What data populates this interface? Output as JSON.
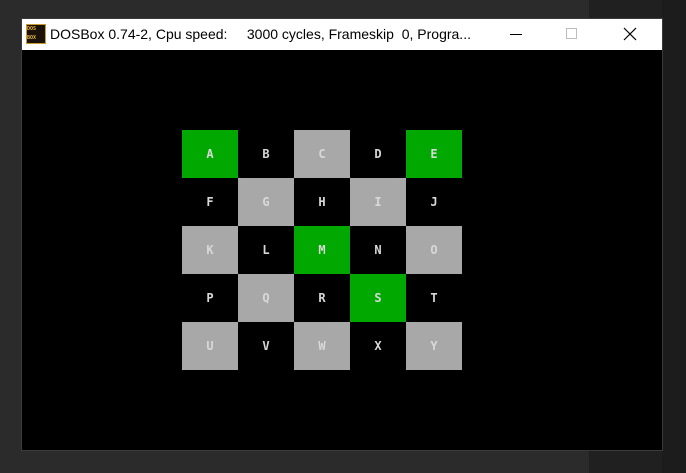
{
  "window": {
    "title": "DOSBox 0.74-2, Cpu speed:     3000 cycles, Frameskip  0, Progra...",
    "icon": "dosbox-icon",
    "icon_text": [
      "DOS",
      "BOX"
    ]
  },
  "controls": {
    "minimize": "minimize-icon",
    "maximize": "maximize-icon",
    "close": "close-icon"
  },
  "colors": {
    "green": "#00a800",
    "gray": "#a8a8a8",
    "black": "#000000",
    "text": "#d8d8d8"
  },
  "grid": {
    "rows": [
      [
        {
          "label": "A",
          "color": "green"
        },
        {
          "label": "B",
          "color": "black"
        },
        {
          "label": "C",
          "color": "gray"
        },
        {
          "label": "D",
          "color": "black"
        },
        {
          "label": "E",
          "color": "green"
        }
      ],
      [
        {
          "label": "F",
          "color": "black"
        },
        {
          "label": "G",
          "color": "gray"
        },
        {
          "label": "H",
          "color": "black"
        },
        {
          "label": "I",
          "color": "gray"
        },
        {
          "label": "J",
          "color": "black"
        }
      ],
      [
        {
          "label": "K",
          "color": "gray"
        },
        {
          "label": "L",
          "color": "black"
        },
        {
          "label": "M",
          "color": "green"
        },
        {
          "label": "N",
          "color": "black"
        },
        {
          "label": "O",
          "color": "gray"
        }
      ],
      [
        {
          "label": "P",
          "color": "black"
        },
        {
          "label": "Q",
          "color": "gray"
        },
        {
          "label": "R",
          "color": "black"
        },
        {
          "label": "S",
          "color": "green"
        },
        {
          "label": "T",
          "color": "black"
        }
      ],
      [
        {
          "label": "U",
          "color": "gray"
        },
        {
          "label": "V",
          "color": "black"
        },
        {
          "label": "W",
          "color": "gray"
        },
        {
          "label": "X",
          "color": "black"
        },
        {
          "label": "Y",
          "color": "gray"
        }
      ]
    ]
  }
}
